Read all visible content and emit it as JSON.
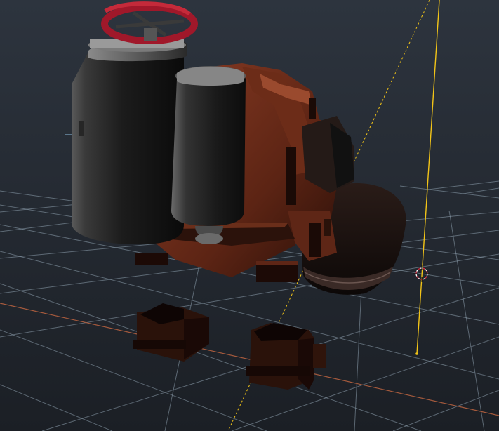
{
  "viewport": {
    "kind": "3d-viewport",
    "background_top": "#2c333d",
    "background_bottom": "#1b1f25"
  },
  "colors": {
    "grid": "#9fb0bd",
    "x_axis": "#b5613f",
    "light_line": "#f2c418",
    "tank_dark": "#151515",
    "tank_light": "#6e6e6e",
    "body_rust": "#7a3520",
    "body_dark": "#2b120b",
    "valve_red": "#a0182a",
    "cursor_red": "#d8283a"
  },
  "icons": {
    "cursor": "3d-cursor-icon",
    "light": "light-object-icon"
  }
}
